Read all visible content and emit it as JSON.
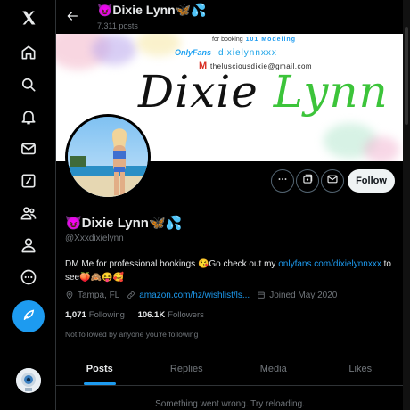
{
  "nav": {
    "icons": [
      "x-logo-icon",
      "home-icon",
      "search-icon",
      "notifications-icon",
      "messages-icon",
      "grok-icon",
      "communities-icon",
      "profile-icon",
      "more-icon"
    ],
    "compose_icon": "feather-icon"
  },
  "header": {
    "name": "😈Dixie Lynn🦋💦",
    "posts_count": "7,311 posts"
  },
  "banner": {
    "booking_text": "for booking",
    "agency": "101 Modeling",
    "onlyfans_logo": "OnlyFans",
    "onlyfans_user": "dixielynnxxx",
    "gmail_logo": "M",
    "email": "thelusciousdixie@gmail.com",
    "script_part1": "Dixie",
    "script_part2": "Lynn"
  },
  "profile": {
    "name": "😈Dixie Lynn🦋💦",
    "handle": "@Xxxdixielynn",
    "bio_text": "DM Me for professional bookings 😘Go check out my ",
    "bio_link": "onlyfans.com/dixielynnxxx",
    "bio_text2": " to see🍑🙈😝🥰",
    "location": "Tampa, FL",
    "website": "amazon.com/hz/wishlist/ls...",
    "joined": "Joined May 2020",
    "following_count": "1,071",
    "following_label": "Following",
    "followers_count": "106.1K",
    "followers_label": "Followers",
    "not_followed": "Not followed by anyone you’re following"
  },
  "actions": {
    "follow_label": "Follow",
    "icons": [
      "more-icon",
      "subscribe-icon",
      "message-icon"
    ]
  },
  "tabs": [
    {
      "label": "Posts",
      "active": true
    },
    {
      "label": "Replies",
      "active": false
    },
    {
      "label": "Media",
      "active": false
    },
    {
      "label": "Likes",
      "active": false
    }
  ],
  "error_message": "Something went wrong. Try reloading.",
  "colors": {
    "accent": "#1d9bf0",
    "background": "#000000",
    "text": "#e7e9ea",
    "muted": "#71767b"
  }
}
